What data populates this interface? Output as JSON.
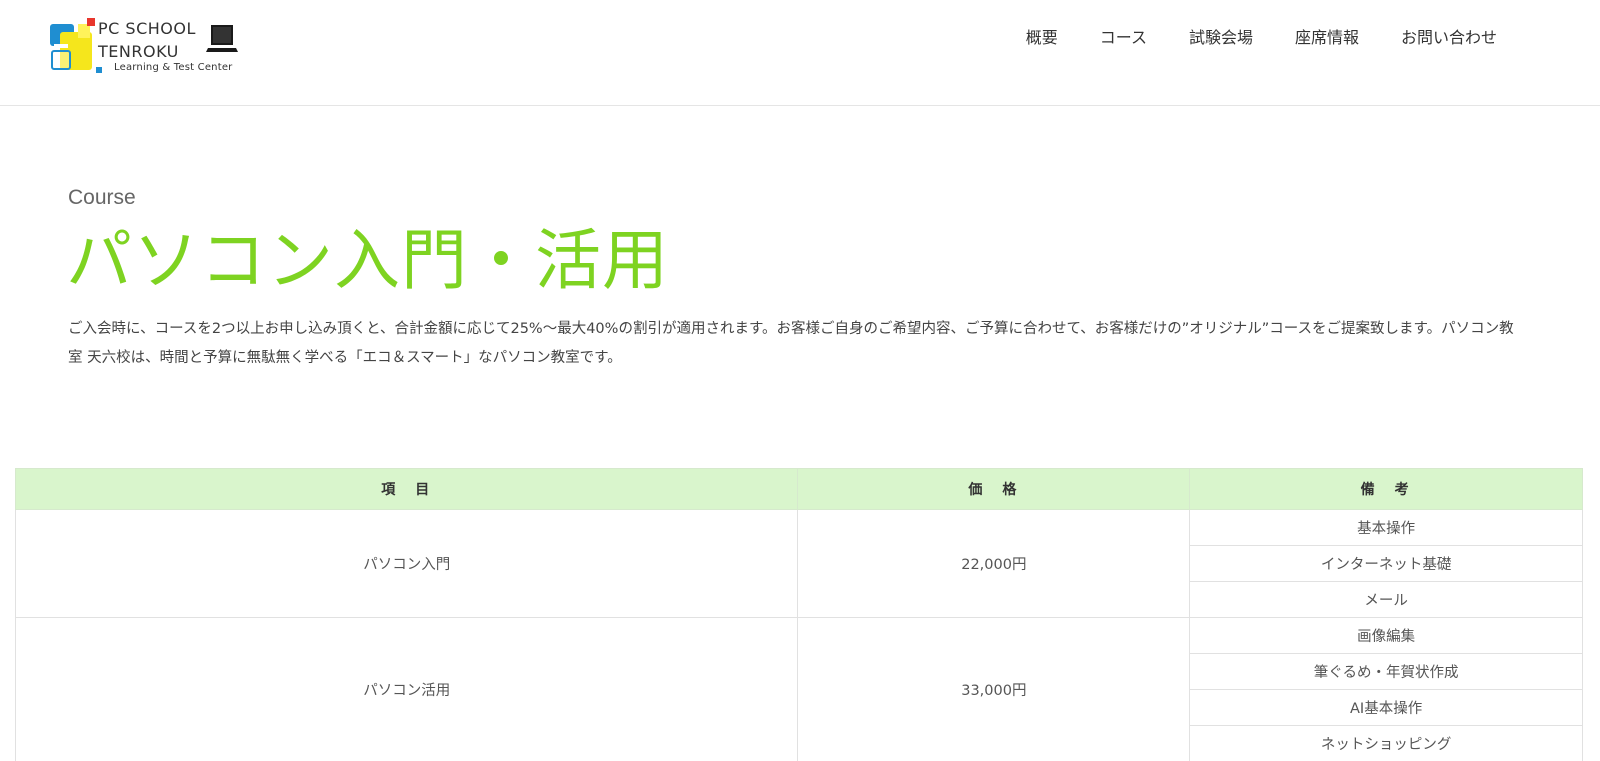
{
  "logo": {
    "line1": "PC SCHOOL",
    "line2": "TENROKU",
    "sub": "Learning & Test Center"
  },
  "nav": {
    "items": [
      {
        "label": "概要"
      },
      {
        "label": "コース"
      },
      {
        "label": "試験会場"
      },
      {
        "label": "座席情報"
      },
      {
        "label": "お問い合わせ"
      }
    ]
  },
  "hero": {
    "eyebrow": "Course",
    "title": "パソコン入門・活用",
    "intro": "ご入会時に、コースを2つ以上お申し込み頂くと、合計金額に応じて25%～最大40%の割引が適用されます。お客様ご自身のご希望内容、ご予算に合わせて、お客様だけの”オリジナル”コースをご提案致します。パソコン教室 天六校は、時間と予算に無駄無く学べる「エコ＆スマート」なパソコン教室です。"
  },
  "table": {
    "headers": [
      "項　目",
      "価　格",
      "備　考"
    ],
    "rows": [
      {
        "item": "パソコン入門",
        "price": "22,000円",
        "notes": [
          "基本操作",
          "インターネット基礎",
          "メール"
        ]
      },
      {
        "item": "パソコン活用",
        "price": "33,000円",
        "notes": [
          "画像編集",
          "筆ぐるめ・年賀状作成",
          "AI基本操作",
          "ネットショッピング"
        ]
      }
    ]
  },
  "colors": {
    "accent": "#7ed321",
    "table_header_bg": "#d9f5cc"
  }
}
